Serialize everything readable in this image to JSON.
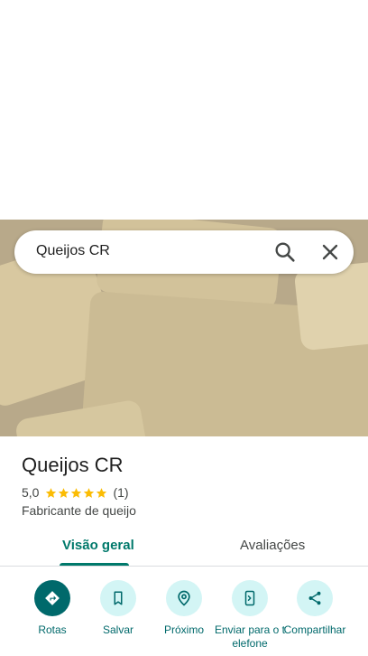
{
  "search": {
    "query": "Queijos CR"
  },
  "place": {
    "name": "Queijos CR",
    "rating": "5,0",
    "stars": 5,
    "review_count": "(1)",
    "category": "Fabricante de queijo"
  },
  "tabs": [
    {
      "label": "Visão geral",
      "active": true
    },
    {
      "label": "Avaliações",
      "active": false
    }
  ],
  "actions": [
    {
      "label": "Rotas",
      "icon": "directions-icon"
    },
    {
      "label": "Salvar",
      "icon": "bookmark-icon"
    },
    {
      "label": "Próximo",
      "icon": "nearby-icon"
    },
    {
      "label": "Enviar para o telefone",
      "icon": "send-to-phone-icon"
    },
    {
      "label": "Compartilhar",
      "icon": "share-icon"
    }
  ],
  "colors": {
    "accent": "#00796b",
    "action_bg": "#d3f5f5",
    "star": "#fbbc04"
  }
}
